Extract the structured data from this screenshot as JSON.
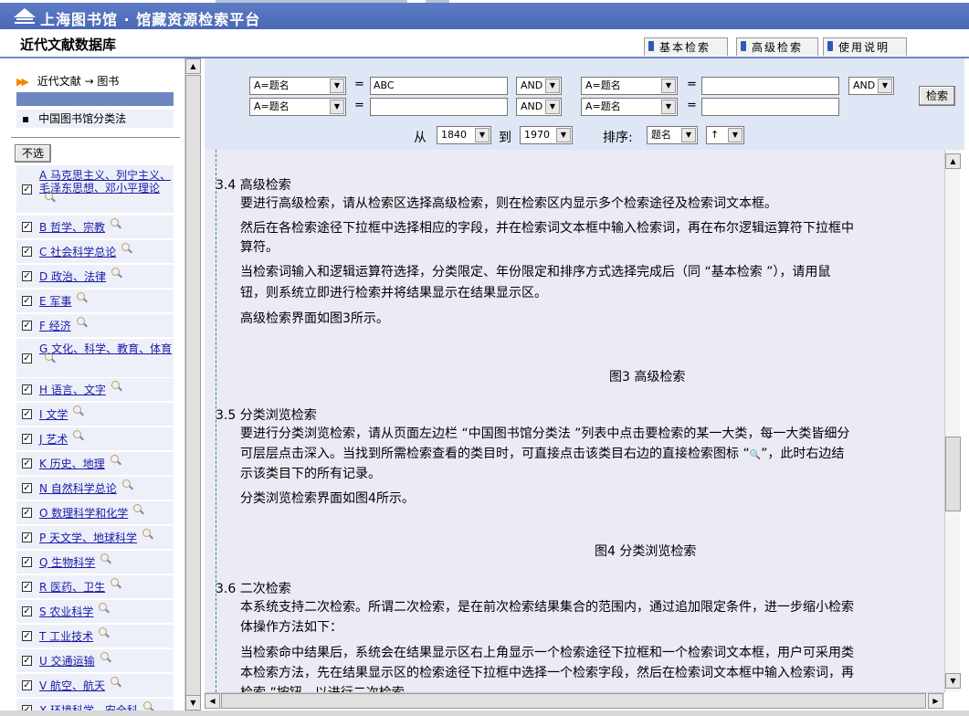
{
  "header": {
    "app_title": "上海图书馆 · 馆藏资源检索平台",
    "db_title": "近代文献数据库",
    "tabs": [
      "基本检索",
      "高级检索",
      "使用说明"
    ]
  },
  "sidebar": {
    "breadcrumb": "近代文献 → 图书",
    "class_title": "中国图书馆分类法",
    "unselect_label": "不选",
    "categories": [
      {
        "label": "A 马克思主义、列宁主义、毛泽东思想、邓小平理论",
        "checked": true
      },
      {
        "label": "B 哲学、宗教",
        "checked": true
      },
      {
        "label": "C 社会科学总论",
        "checked": true
      },
      {
        "label": "D 政治、法律",
        "checked": true
      },
      {
        "label": "E 军事",
        "checked": true
      },
      {
        "label": "F 经济",
        "checked": true
      },
      {
        "label": "G 文化、科学、教育、体育",
        "checked": true
      },
      {
        "label": "H 语言、文字",
        "checked": true
      },
      {
        "label": "I 文学",
        "checked": true
      },
      {
        "label": "J 艺术",
        "checked": true
      },
      {
        "label": "K 历史、地理",
        "checked": true
      },
      {
        "label": "N 自然科学总论",
        "checked": true
      },
      {
        "label": "O 数理科学和化学",
        "checked": true
      },
      {
        "label": "P 天文学、地球科学",
        "checked": true
      },
      {
        "label": "Q 生物科学",
        "checked": true
      },
      {
        "label": "R 医药、卫生",
        "checked": true
      },
      {
        "label": "S 农业科学",
        "checked": true
      },
      {
        "label": "T 工业技术",
        "checked": true
      },
      {
        "label": "U 交通运输",
        "checked": true
      },
      {
        "label": "V 航空、航天",
        "checked": true
      },
      {
        "label": "X 环境科学、安全科",
        "checked": true
      }
    ]
  },
  "search": {
    "field1": "A=题名",
    "value1": "ABC",
    "op1": "AND",
    "field2": "A=题名",
    "value2": "",
    "op2": "AND",
    "field3": "A=题名",
    "value3": "",
    "field4": "A=题名",
    "value4": "",
    "op_row1_end": "AND",
    "eq": "=",
    "search_button": "检索",
    "from_label": "从",
    "from_year": "1840",
    "to_label": "到",
    "to_year": "1970",
    "sort_label": "排序:",
    "sort_field": "题名",
    "sort_dir": "↑"
  },
  "content": {
    "s34_title": "3.4  高级检索",
    "s34_p1": "要进行高级检索，请从检索区选择高级检索，则在检索区内显示多个检索途径及检索词文本框。",
    "s34_p2a": "然后在各检索途径下拉框中选择相应的字段，并在检索词文本框中输入检索词，再在布尔逻辑运算符下拉框中",
    "s34_p2b": "算符。",
    "s34_p3a": "当检索词输入和逻辑运算符选择，分类限定、年份限定和排序方式选择完成后（同 “基本检索 ”），请用鼠",
    "s34_p3b": "钮，则系统立即进行检索并将结果显示在结果显示区。",
    "s34_p4": "高级检索界面如图3所示。",
    "fig3": "图3  高级检索",
    "s35_title": "3.5  分类浏览检索",
    "s35_p1a": "要进行分类浏览检索，请从页面左边栏 “中国图书馆分类法 ”列表中点击要检索的某一大类，每一大类皆细分",
    "s35_p1b": "可层层点击深入。当找到所需检索查看的类目时，可直接点击该类目右边的直接检索图标 “",
    "s35_p1b2": "”，此时右边结",
    "s35_p1c": "示该类目下的所有记录。",
    "s35_p2": "分类浏览检索界面如图4所示。",
    "fig4": "图4  分类浏览检索",
    "s36_title": "3.6  二次检索",
    "s36_p1a": "本系统支持二次检索。所谓二次检索，是在前次检索结果集合的范围内，通过追加限定条件，进一步缩小检索",
    "s36_p1b": "体操作方法如下：",
    "s36_p2a": "当检索命中结果后，系统会在结果显示区右上角显示一个检索途径下拉框和一个检索词文本框，用户可采用类",
    "s36_p2b": "本检索方法，先在结果显示区的检索途径下拉框中选择一个检索字段，然后在检索词文本框中输入检索词，再",
    "s36_p2c": "检索 ”按钮，以进行二次检索"
  },
  "colors": {
    "header_blue": "#4a69b6",
    "panel_blue": "#dfe7f6",
    "content_bg": "#ebebf6",
    "link": "#1a1aa8"
  }
}
